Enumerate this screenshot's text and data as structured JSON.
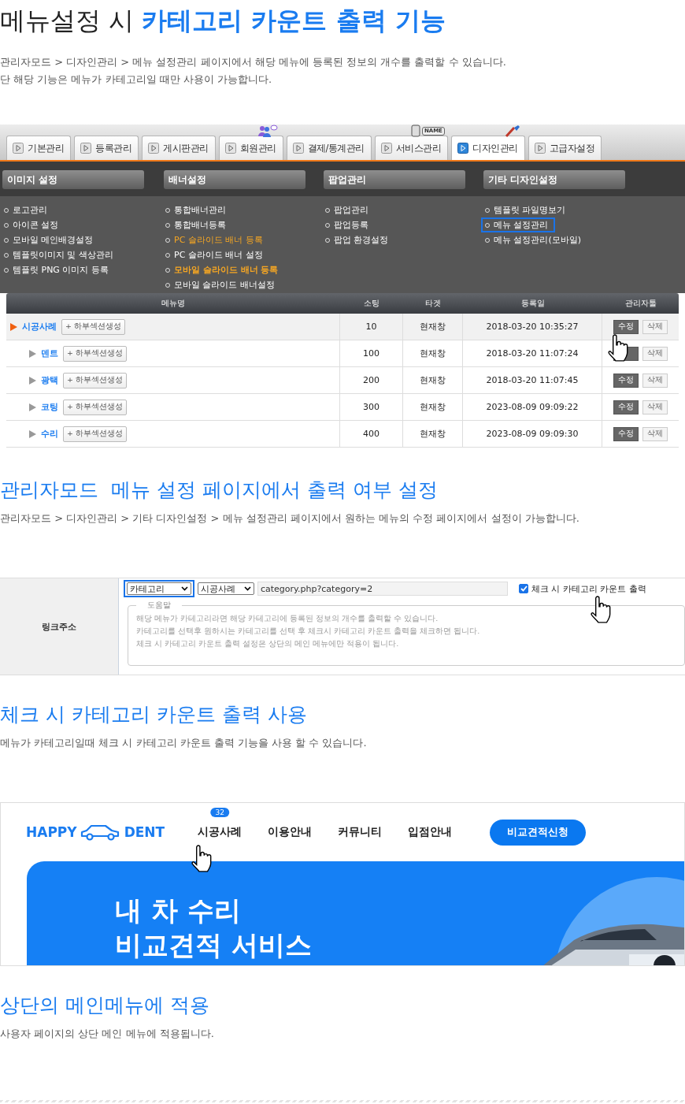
{
  "title": "메뉴설정 시 **카테고리 카운트 출력 기능**",
  "intro": [
    "관리자모드 > 디자인관리 > 메뉴 설정관리 페이지에서 해당 메뉴에 등록된 정보의 개수를 출력할 수 있습니다.",
    "단 해당 기능은 메뉴가 카테고리일 때만 사용이 가능합니다."
  ],
  "admin_shot": {
    "tabs": [
      {
        "label": "기본관리",
        "selected": false,
        "kind": "plain"
      },
      {
        "label": "등록관리",
        "selected": false,
        "kind": "plain"
      },
      {
        "label": "게시판관리",
        "selected": false,
        "kind": "plain"
      },
      {
        "label": "회원관리",
        "selected": false,
        "kind": "people"
      },
      {
        "label": "결제/통계관리",
        "selected": false,
        "kind": "plain"
      },
      {
        "label": "서비스관리",
        "selected": false,
        "kind": "phone",
        "badge": "NAME"
      },
      {
        "label": "디자인관리",
        "selected": true,
        "kind": "brush"
      },
      {
        "label": "고급자설정",
        "selected": false,
        "kind": "plain"
      }
    ],
    "menu_columns": [
      {
        "heading": "이미지 설정",
        "items": [
          {
            "label": "로고관리",
            "kind": "plain",
            "framed": false
          },
          {
            "label": "아이콘 설정",
            "kind": "plain",
            "framed": false
          },
          {
            "label": "모바일 메인배경설정",
            "kind": "plain",
            "framed": false
          },
          {
            "label": "템플릿이미지 및 색상관리",
            "kind": "plain",
            "framed": false
          },
          {
            "label": "템플릿 PNG 이미지 등록",
            "kind": "plain",
            "framed": false
          }
        ]
      },
      {
        "heading": "배너설정",
        "items": [
          {
            "label": "통합배너관리",
            "kind": "plain",
            "framed": false
          },
          {
            "label": "통합배너등록",
            "kind": "plain",
            "framed": false
          },
          {
            "label": "PC 슬라이드 배너 등록",
            "kind": "accent",
            "framed": false
          },
          {
            "label": "PC 슬라이드 배너 설정",
            "kind": "plain",
            "framed": false
          },
          {
            "label": "모바일 슬라이드 배너 등록",
            "kind": "accent_bold",
            "framed": false
          },
          {
            "label": "모바일 슬라이드 배너설정",
            "kind": "plain",
            "framed": false
          }
        ]
      },
      {
        "heading": "팝업관리",
        "items": [
          {
            "label": "팝업관리",
            "kind": "plain",
            "framed": false
          },
          {
            "label": "팝업등록",
            "kind": "plain",
            "framed": false
          },
          {
            "label": "팝업 환경설정",
            "kind": "plain",
            "framed": false
          }
        ]
      },
      {
        "heading": "기타 디자인설정",
        "items": [
          {
            "label": "템플릿 파일명보기",
            "kind": "plain",
            "framed": false
          },
          {
            "label": "메뉴 설정관리",
            "kind": "plain",
            "framed": true
          },
          {
            "label": "메뉴 설정관리(모바일)",
            "kind": "plain",
            "framed": false
          }
        ]
      }
    ],
    "table": {
      "columns": [
        "메뉴명",
        "소팅",
        "타겟",
        "등록일",
        "관리자툴"
      ],
      "rows": [
        {
          "name": "시공사례",
          "add_button": "+ 하부섹션생성",
          "sort": "10",
          "target": "현재창",
          "date": "2018-03-20 10:35:27",
          "edit": "수정",
          "delete": "삭제",
          "selected": true,
          "children": [
            {
              "name": "덴트",
              "add_button": "+ 하부섹션생성",
              "sort": "100",
              "target": "현재창",
              "date": "2018-03-20 11:07:24",
              "delete": "삭제",
              "selected": false
            },
            {
              "name": "광택",
              "add_button": "+ 하부섹션생성",
              "sort": "200",
              "target": "현재창",
              "date": "2018-03-20 11:07:45",
              "edit": "수정",
              "delete": "삭제",
              "selected": false
            },
            {
              "name": "코팅",
              "add_button": "+ 하부섹션생성",
              "sort": "300",
              "target": "현재창",
              "date": "2023-08-09 09:09:22",
              "edit": "수정",
              "delete": "삭제",
              "selected": false
            },
            {
              "name": "수리",
              "add_button": "+ 하부섹션생성",
              "sort": "400",
              "target": "현재창",
              "date": "2023-08-09 09:09:30",
              "edit": "수정",
              "delete": "삭제",
              "selected": false
            }
          ]
        }
      ]
    }
  },
  "section_2": {
    "title": "관리자모드  메뉴 설정 페이지에서 출력 여부 설정",
    "description": "관리자모드 > 디자인관리 > 기타 디자인설정 > 메뉴 설정관리 페이지에서 원하는 메뉴의 수정 페이지에서 설정이 가능합니다."
  },
  "link_shot": {
    "label": "링크주소",
    "type_select": "카테고리",
    "category_select": "시공사례",
    "url": "category.php?category=2",
    "count_checkbox": {
      "label": "체크 시 카테고리 카운트 출력",
      "checked": true
    },
    "help_label": "도움말",
    "help_lines": [
      "해당 메뉴가 카테고리라면 해당 카테고리에 등록된 정보의 개수를 출력할 수 있습니다.",
      "카테고리를 선택후 원하시는 카테고리를 선택 후 체크시 카테고리 카운트 출력을 체크하면 됩니다.",
      "체크 시 카테고리 카운트 출력 설정은 상단의 메인 메뉴에만 적용이 됩니다."
    ]
  },
  "section_3": {
    "title": "체크 시 카테고리 카운트 출력 사용",
    "description": "메뉴가 카테고리일때 체크 시 카테고리 카운트 출력 기능을 사용 할 수 있습니다."
  },
  "site_shot": {
    "logo_left": "HAPPY",
    "logo_right": "DENT",
    "nav": [
      {
        "label": "시공사례",
        "count": "32"
      },
      {
        "label": "이용안내"
      },
      {
        "label": "커뮤니티"
      },
      {
        "label": "입점안내"
      }
    ],
    "cta": "비교견적신청",
    "banner_lines": [
      "내 차 수리",
      "비교견적 서비스"
    ]
  },
  "section_4": {
    "title": "상단의 메인메뉴에 적용",
    "description": "사용자 페이지의 상단 메인 메뉴에 적용됩니다."
  }
}
